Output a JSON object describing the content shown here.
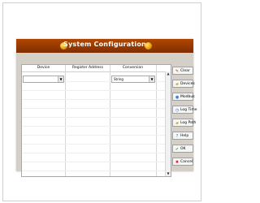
{
  "dialog": {
    "title": "System Configuration"
  },
  "table": {
    "columns": [
      "Device",
      "Register Address",
      "Conversion"
    ],
    "first_row": {
      "device": "",
      "conversion": "String"
    }
  },
  "buttons": {
    "clear": "Clear",
    "devices": "Devices",
    "modbus": "Modbus",
    "log_time": "Log Time",
    "log_path": "Log Path",
    "help": "Help",
    "ok": "OK",
    "cancel": "Cancel"
  },
  "colors": {
    "titlebar": "#9b3c00",
    "title_orb": "#f0a000",
    "dialog_bg": "#d4d0c8"
  },
  "icons": {
    "clear": "pencil-icon",
    "devices": "folder-icon",
    "modbus": "circle-icon",
    "log_time": "clock-icon",
    "log_path": "folder-icon",
    "help": "help-icon",
    "ok": "check-icon",
    "cancel": "x-icon"
  }
}
